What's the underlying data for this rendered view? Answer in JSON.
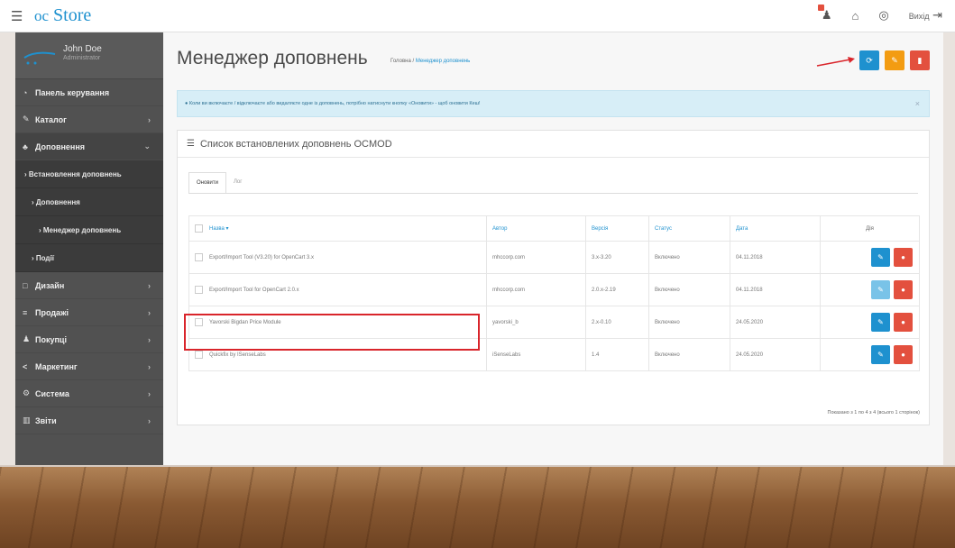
{
  "header": {
    "logo_prefix": "oc",
    "logo_main": "Store",
    "exit_label": "Вихід"
  },
  "sidebar": {
    "user_name": "John Doe",
    "user_role": "Administrator",
    "items": [
      {
        "icon": "◔",
        "label": "Панель керування",
        "chev": ""
      },
      {
        "icon": "✎",
        "label": "Каталог",
        "chev": "›"
      },
      {
        "icon": "♣",
        "label": "Доповнення",
        "chev": "⌄"
      }
    ],
    "sub": [
      {
        "label": "› Встановлення доповнень"
      },
      {
        "label": "› Доповнення"
      },
      {
        "label": "› Менеджер доповнень"
      },
      {
        "label": "› Події"
      }
    ],
    "items2": [
      {
        "icon": "□",
        "label": "Дизайн",
        "chev": "›"
      },
      {
        "icon": "≡",
        "label": "Продажі",
        "chev": "›"
      },
      {
        "icon": "♟",
        "label": "Покупці",
        "chev": "›"
      },
      {
        "icon": "<",
        "label": "Маркетинг",
        "chev": "›"
      },
      {
        "icon": "⚙",
        "label": "Система",
        "chev": "›"
      },
      {
        "icon": "▥",
        "label": "Звіти",
        "chev": "›"
      }
    ]
  },
  "page": {
    "title": "Менеджер доповнень",
    "breadcrumb_home": "Головна",
    "breadcrumb_sep": " / ",
    "breadcrumb_current": "Менеджер доповнень",
    "alert": "Коли ви включаєте / відключаєте або видаляєте одне із доповнень, потрібно натиснути кнопку «Оновити» - щоб оновити Кеш!",
    "panel_title": "Список встановлених доповнень OCMOD",
    "tab_active": "Оновити",
    "tab_other": "Лог",
    "pagination": "Показано з 1 по 4 з 4 (всього 1 сторінок)"
  },
  "table": {
    "headers": {
      "name": "Назва ▾",
      "author": "Автор",
      "version": "Версія",
      "status": "Статус",
      "date": "Дата",
      "actions": "Дія"
    },
    "rows": [
      {
        "name": "Export/Import Tool (V3.20) for OpenCart 3.x",
        "author": "mhccorp.com",
        "version": "3.x-3.20",
        "status": "Включено",
        "date": "04.11.2018"
      },
      {
        "name": "Export/Import Tool for OpenCart 2.0.x",
        "author": "mhccorp.com",
        "version": "2.0.x-2.19",
        "status": "Включено",
        "date": "04.11.2018"
      },
      {
        "name": "Yavorski Bigdan Price Module",
        "author": "yavorski_b",
        "version": "2.x-0.10",
        "status": "Включено",
        "date": "24.05.2020"
      },
      {
        "name": "Quickfix by ISenseLabs",
        "author": "iSenseLabs",
        "version": "1.4",
        "status": "Включено",
        "date": "24.05.2020"
      }
    ]
  },
  "colors": {
    "primary": "#1e91cf",
    "warning": "#f39c12",
    "danger": "#e3503e",
    "sidebar": "#515151",
    "highlight": "#d9252b"
  }
}
